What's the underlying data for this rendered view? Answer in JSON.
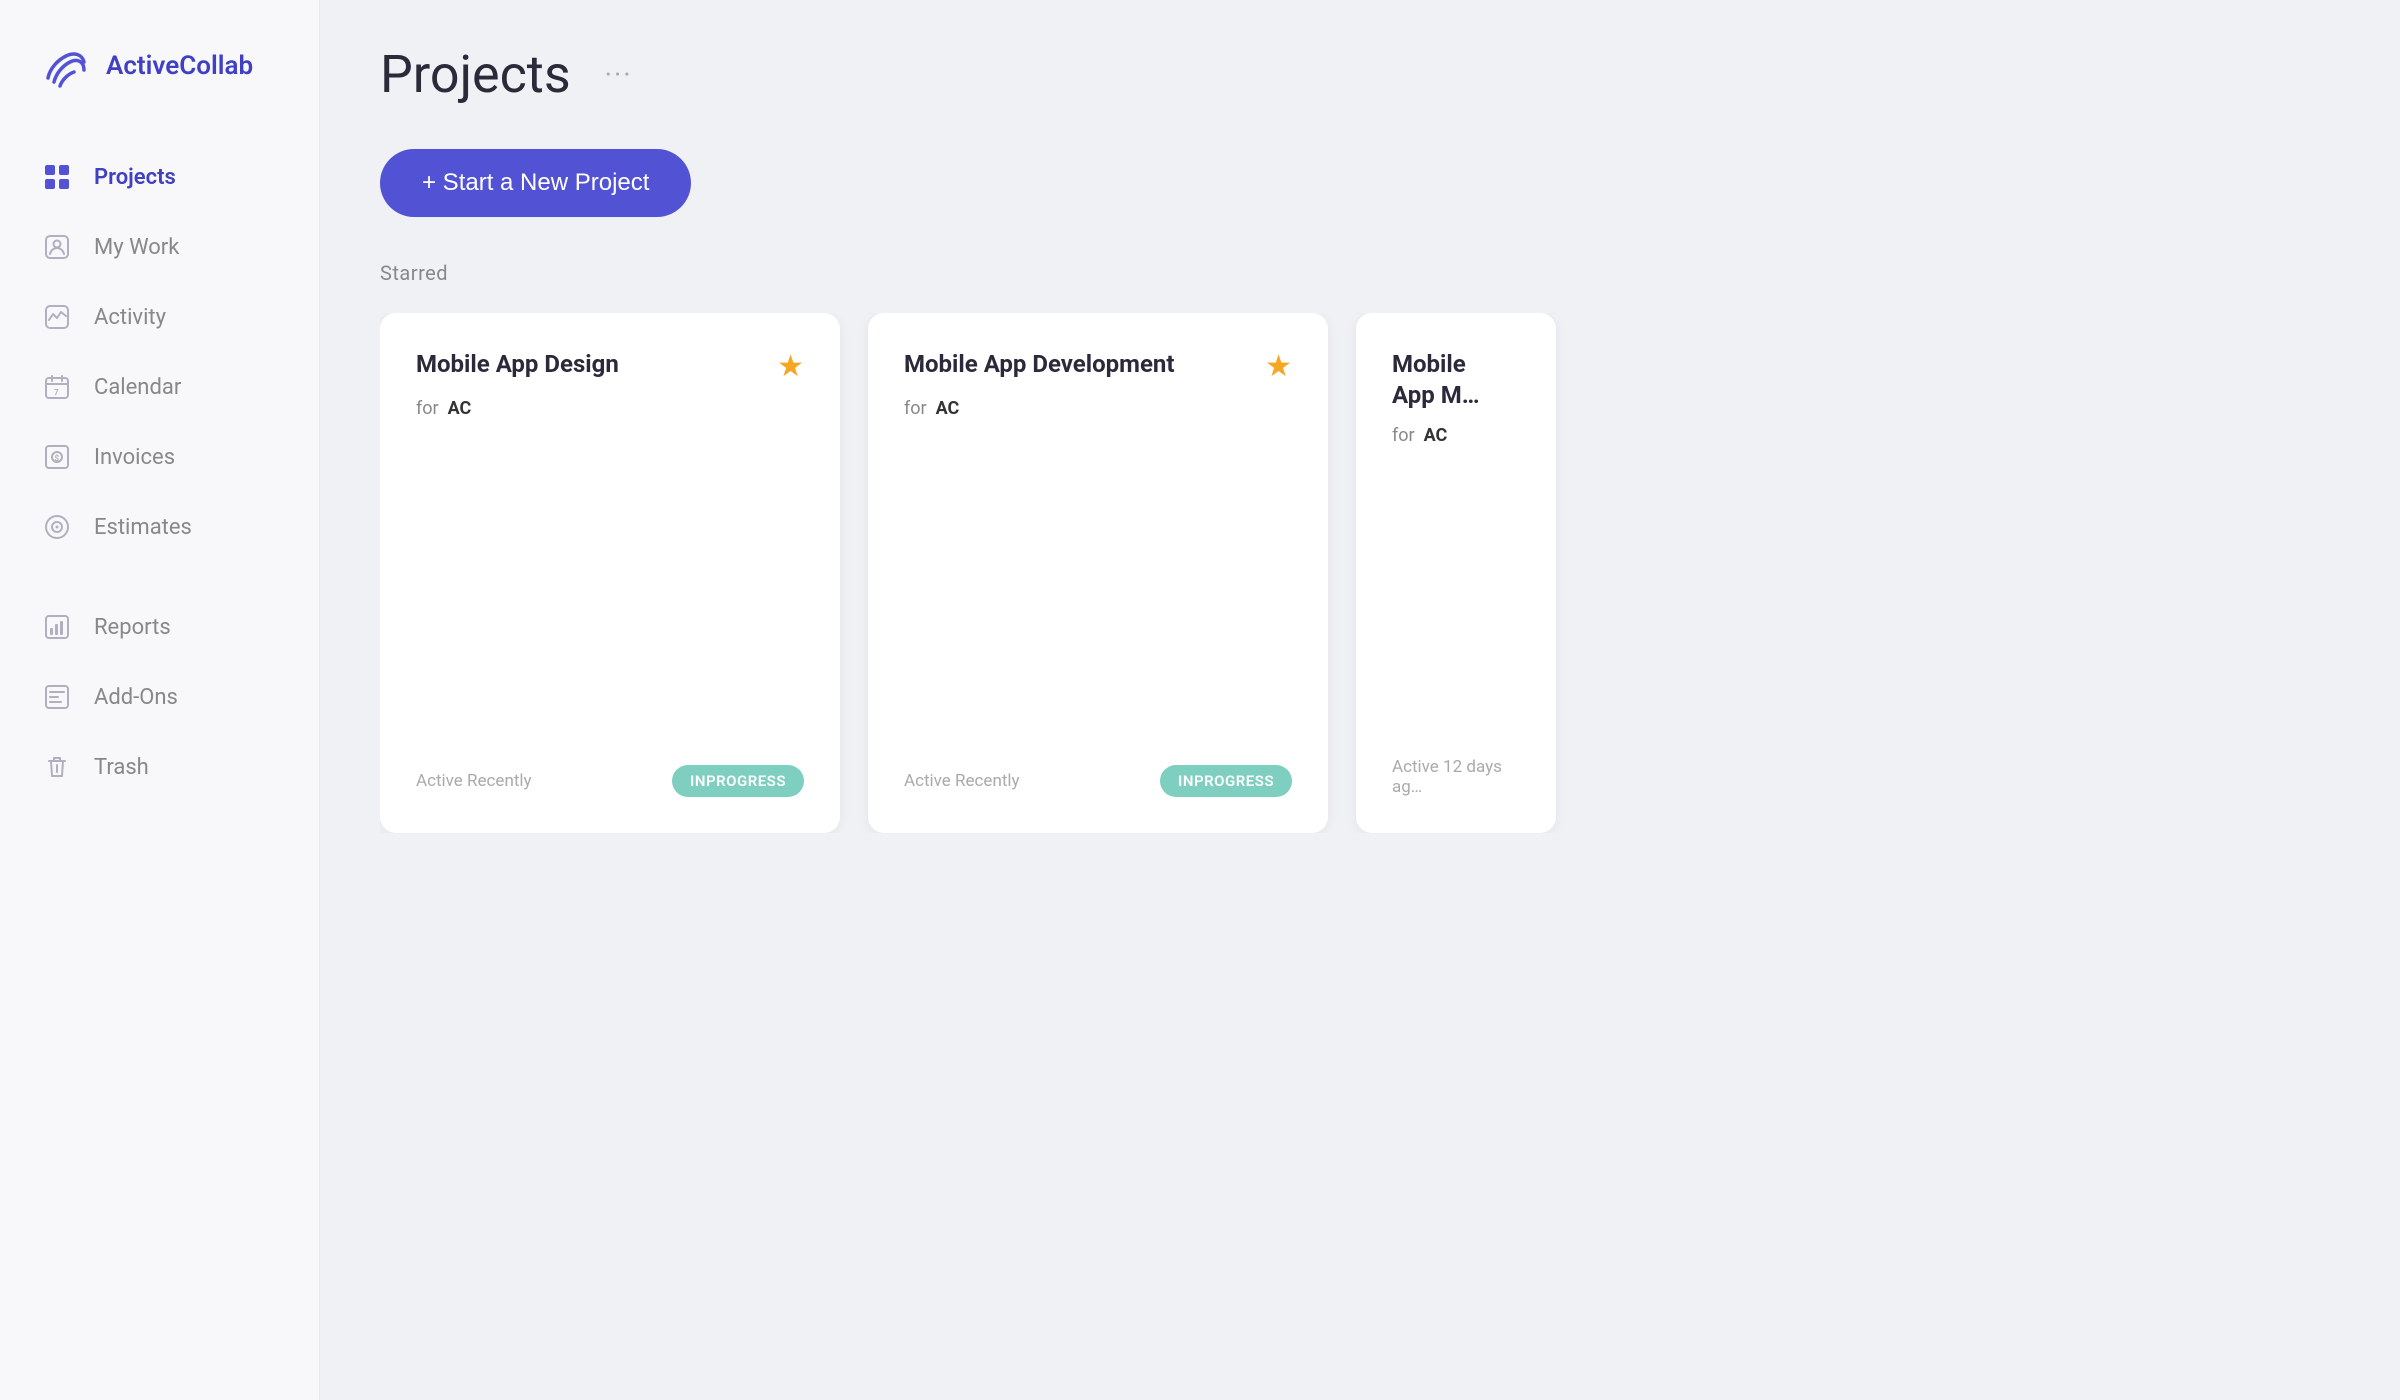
{
  "app": {
    "name": "ActiveCollab"
  },
  "sidebar": {
    "items": [
      {
        "id": "projects",
        "label": "Projects",
        "active": true
      },
      {
        "id": "my-work",
        "label": "My Work",
        "active": false
      },
      {
        "id": "activity",
        "label": "Activity",
        "active": false
      },
      {
        "id": "calendar",
        "label": "Calendar",
        "active": false
      },
      {
        "id": "invoices",
        "label": "Invoices",
        "active": false
      },
      {
        "id": "estimates",
        "label": "Estimates",
        "active": false
      },
      {
        "id": "reports",
        "label": "Reports",
        "active": false
      },
      {
        "id": "add-ons",
        "label": "Add-Ons",
        "active": false
      },
      {
        "id": "trash",
        "label": "Trash",
        "active": false
      }
    ]
  },
  "header": {
    "title": "Projects",
    "menu_icon": "···"
  },
  "new_project_btn": "+ Start a New Project",
  "starred_label": "Starred",
  "projects": [
    {
      "title": "Mobile App Design",
      "client_prefix": "for",
      "client": "AC",
      "starred": true,
      "active_text": "Active Recently",
      "status": "INPROGRESS"
    },
    {
      "title": "Mobile App Development",
      "client_prefix": "for",
      "client": "AC",
      "starred": true,
      "active_text": "Active Recently",
      "status": "INPROGRESS"
    },
    {
      "title": "Mobile App M…",
      "client_prefix": "for",
      "client": "AC",
      "starred": false,
      "active_text": "Active 12 days ag…",
      "status": ""
    }
  ]
}
